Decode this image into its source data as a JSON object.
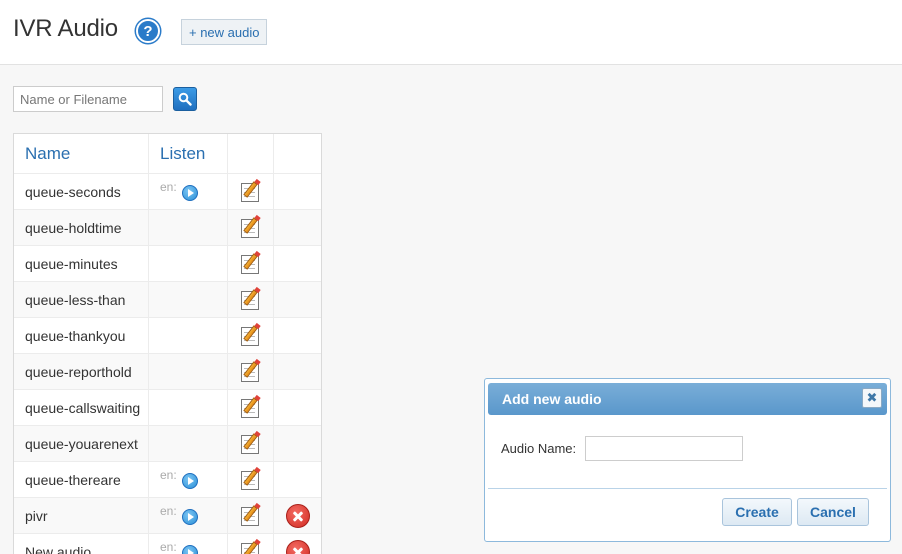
{
  "header": {
    "title": "IVR Audio",
    "help_glyph": "?",
    "new_audio_label": "+ new audio"
  },
  "search": {
    "placeholder": "Name or Filename"
  },
  "table": {
    "columns": {
      "name": "Name",
      "listen": "Listen"
    },
    "rows": [
      {
        "name": "queue-seconds",
        "lang": "en:",
        "playable": true,
        "deletable": false
      },
      {
        "name": "queue-holdtime",
        "lang": "",
        "playable": false,
        "deletable": false
      },
      {
        "name": "queue-minutes",
        "lang": "",
        "playable": false,
        "deletable": false
      },
      {
        "name": "queue-less-than",
        "lang": "",
        "playable": false,
        "deletable": false
      },
      {
        "name": "queue-thankyou",
        "lang": "",
        "playable": false,
        "deletable": false
      },
      {
        "name": "queue-reporthold",
        "lang": "",
        "playable": false,
        "deletable": false
      },
      {
        "name": "queue-callswaiting",
        "lang": "",
        "playable": false,
        "deletable": false
      },
      {
        "name": "queue-youarenext",
        "lang": "",
        "playable": false,
        "deletable": false
      },
      {
        "name": "queue-thereare",
        "lang": "en:",
        "playable": true,
        "deletable": false
      },
      {
        "name": "pivr",
        "lang": "en:",
        "playable": true,
        "deletable": true
      },
      {
        "name": "New audio",
        "lang": "en:",
        "playable": true,
        "deletable": true
      }
    ]
  },
  "dialog": {
    "title": "Add new audio",
    "close_glyph": "✖",
    "field_label": "Audio Name:",
    "field_value": "",
    "create_label": "Create",
    "cancel_label": "Cancel"
  },
  "icons": {
    "help": "help-icon",
    "search": "search-icon",
    "play": "play-icon",
    "edit": "edit-icon",
    "delete": "delete-icon",
    "close": "close-icon"
  },
  "colors": {
    "accent": "#2a6fb0",
    "dialog_title_bg": "#6aa3d2",
    "delete": "#d22b22"
  }
}
